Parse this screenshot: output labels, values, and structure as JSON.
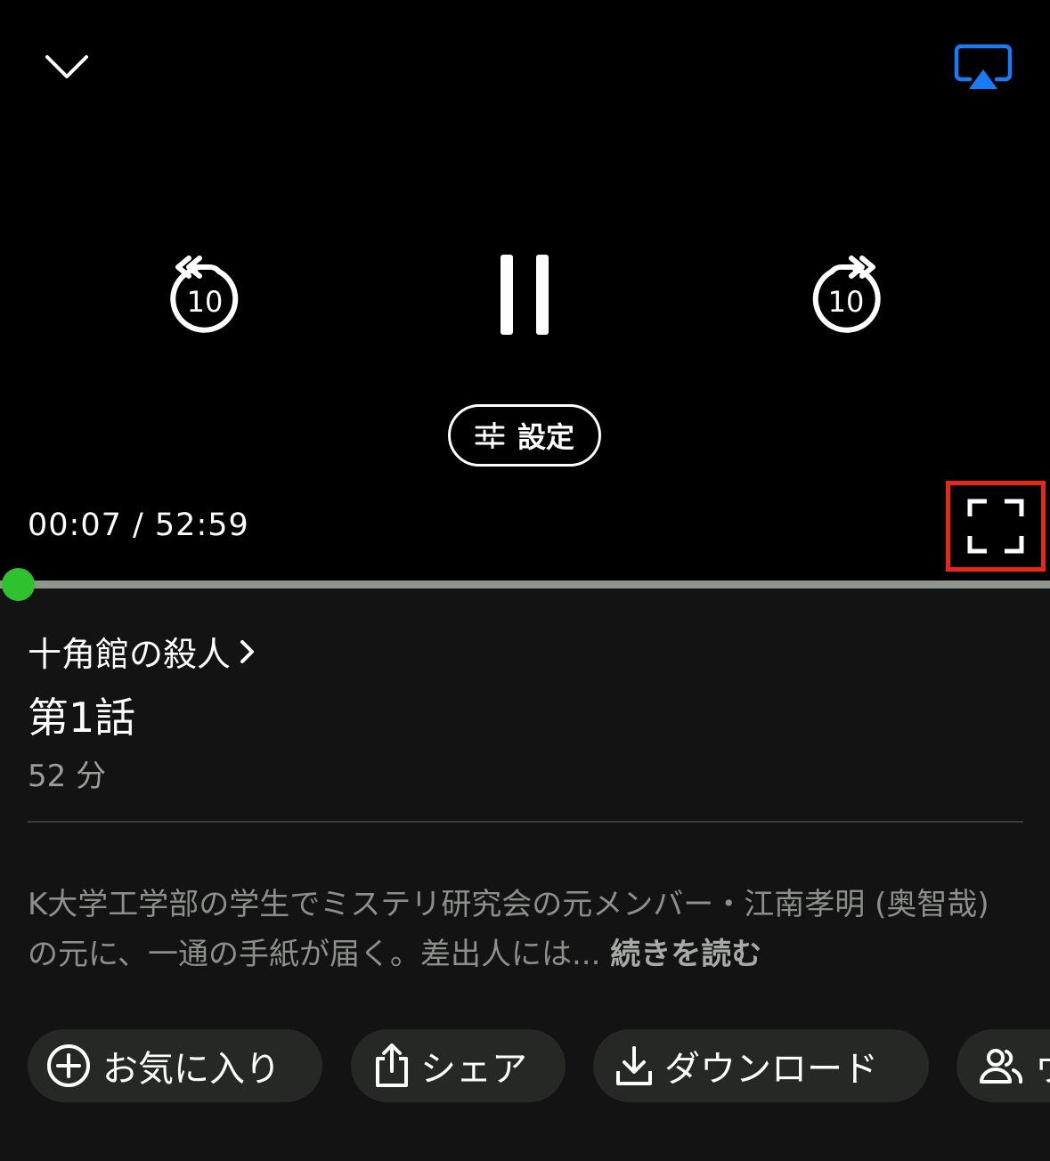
{
  "player": {
    "settings_label": "設定",
    "time_display": "00:07 / 52:59",
    "skip_back_seconds": "10",
    "skip_forward_seconds": "10",
    "progress": 0.002,
    "accent_color": "#2fc22f",
    "airplay_color": "#1a7cf5",
    "highlight_color": "#e8261a"
  },
  "episode": {
    "series_title": "十角館の殺人",
    "title": "第1話",
    "duration": "52 分",
    "description": "K大学工学部の学生でミステリ研究会の元メンバー・江南孝明 (奥智哉) の元に、一通の手紙が届く。差出人には...",
    "read_more": "続きを読む"
  },
  "actions": [
    {
      "label": "お気に入り",
      "icon": "add-circle-icon"
    },
    {
      "label": "シェア",
      "icon": "share-icon"
    },
    {
      "label": "ダウンロード",
      "icon": "download-icon"
    },
    {
      "label": "ウ",
      "icon": "watch-party-icon"
    }
  ]
}
